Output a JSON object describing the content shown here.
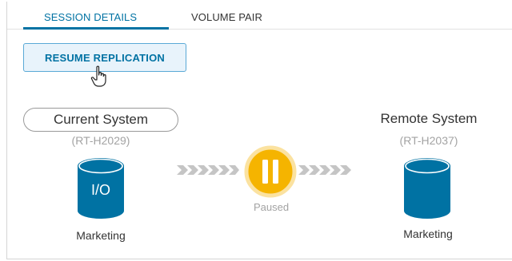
{
  "tabs": [
    {
      "label": "SESSION DETAILS",
      "active": true
    },
    {
      "label": "VOLUME PAIR",
      "active": false
    }
  ],
  "actions": {
    "resume_label": "RESUME REPLICATION"
  },
  "current_system": {
    "title": "Current System",
    "id": "(RT-H2029)",
    "icon_text": "I/O",
    "volume_label": "Marketing"
  },
  "remote_system": {
    "title": "Remote System",
    "id": "(RT-H2037)",
    "volume_label": "Marketing"
  },
  "replication": {
    "status": "Paused"
  },
  "icons": {
    "pause": "pause-icon",
    "db": "database-icon",
    "arrows": "chevron-arrows-icon",
    "cursor": "hand-pointer-icon"
  },
  "colors": {
    "primary": "#0072a3",
    "pause": "#f5b400",
    "muted": "#a3a3a3",
    "arrow": "#c5c5c5"
  }
}
